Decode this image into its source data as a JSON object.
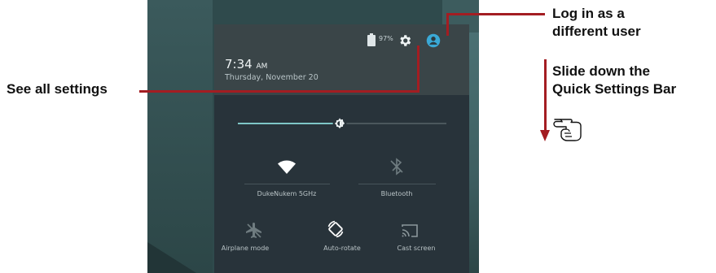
{
  "status_bar": {
    "battery_percent": "97%",
    "icons": [
      "battery-icon",
      "gear-icon",
      "user-account-icon"
    ]
  },
  "header": {
    "time": "7:34",
    "ampm": "AM",
    "date": "Thursday, November 20"
  },
  "brightness": {
    "level_percent": 49,
    "icon": "brightness-icon"
  },
  "quick_settings": {
    "tiles": [
      {
        "label": "DukeNukem 5GHz",
        "icon": "wifi-icon",
        "active": true
      },
      {
        "label": "Bluetooth",
        "icon": "bluetooth-off-icon",
        "active": false
      },
      {
        "label": "Airplane mode",
        "icon": "airplane-mode-off-icon",
        "active": false
      },
      {
        "label": "Auto-rotate",
        "icon": "auto-rotate-icon",
        "active": true
      },
      {
        "label": "Cast screen",
        "icon": "cast-screen-icon",
        "active": false
      }
    ]
  },
  "annotations": {
    "settings_callout": "See all settings",
    "user_callout_line1": "Log in as a",
    "user_callout_line2": "different user",
    "slide_callout_line1": "Slide down the",
    "slide_callout_line2": "Quick Settings Bar",
    "accent_color": "#a31d22"
  }
}
